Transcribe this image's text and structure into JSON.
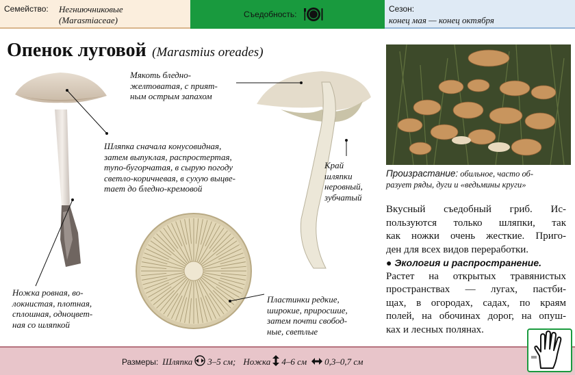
{
  "header": {
    "family_label": "Семейство:",
    "family_ru": "Негниючниковые",
    "family_lat": "(Marasmiaceae)",
    "edibility_label": "Съедобность:",
    "edibility_icon": "plate-fork-knife-icon",
    "season_label": "Сезон:",
    "season_value": "конец мая — конец октября",
    "colors": {
      "family_bg": "#fbeedd",
      "edibility_bg": "#199a3e",
      "season_bg": "#dfeaf5"
    }
  },
  "title": {
    "name": "Опенок луговой",
    "latin": "(Marasmius oreades)"
  },
  "callouts": {
    "flesh": [
      "Мякоть бледно-",
      "желтоватая, с прият-",
      "ным острым запахом"
    ],
    "cap": [
      "Шляпка сначала конусовидная,",
      "затем выпуклая, распростертая,",
      "тупо-бугорчатая, в сырую погоду",
      "светло-коричневая, в сухую выцве-",
      "тает до бледно-кремовой"
    ],
    "edge": [
      "Край",
      "шляпки",
      "неровный,",
      "зубчатый"
    ],
    "stem": [
      "Ножка ровная, во-",
      "локнистая, плотная,",
      "сплошная, одноцвет-",
      "ная со шляпкой"
    ],
    "gills": [
      "Пластинки редкие,",
      "широкие, приросшие,",
      "затем почти свобод-",
      "ные, светлые"
    ]
  },
  "habitat": {
    "label": "Произрастание:",
    "text_1": " обильное, часто об-",
    "line_2": "разует ряды, дуги и «ведьмины круги»"
  },
  "description": {
    "lines": [
      "Вкусный съедобный гриб. Ис-",
      "пользуются только шляпки, так",
      "как ножки очень жесткие. Приго-",
      "ден для всех видов переработки."
    ],
    "ecology_heading": "Экология и распространение.",
    "ecology_lines": [
      "Растет на открытых травянистых",
      "пространствах — лугах, пастби-",
      "щах, в огородах, садах, по краям",
      "полей, на обочинах дорог, на опуш-",
      "ках и лесных полянах."
    ]
  },
  "footer": {
    "sizes_label": "Размеры:",
    "cap_label": "Шляпка",
    "cap_size": "3–5 см;",
    "stem_label": "Ножка",
    "stem_height": "4–6 см",
    "stem_diameter": "0,3–0,7 см",
    "hand_icon": "hand-icon"
  }
}
